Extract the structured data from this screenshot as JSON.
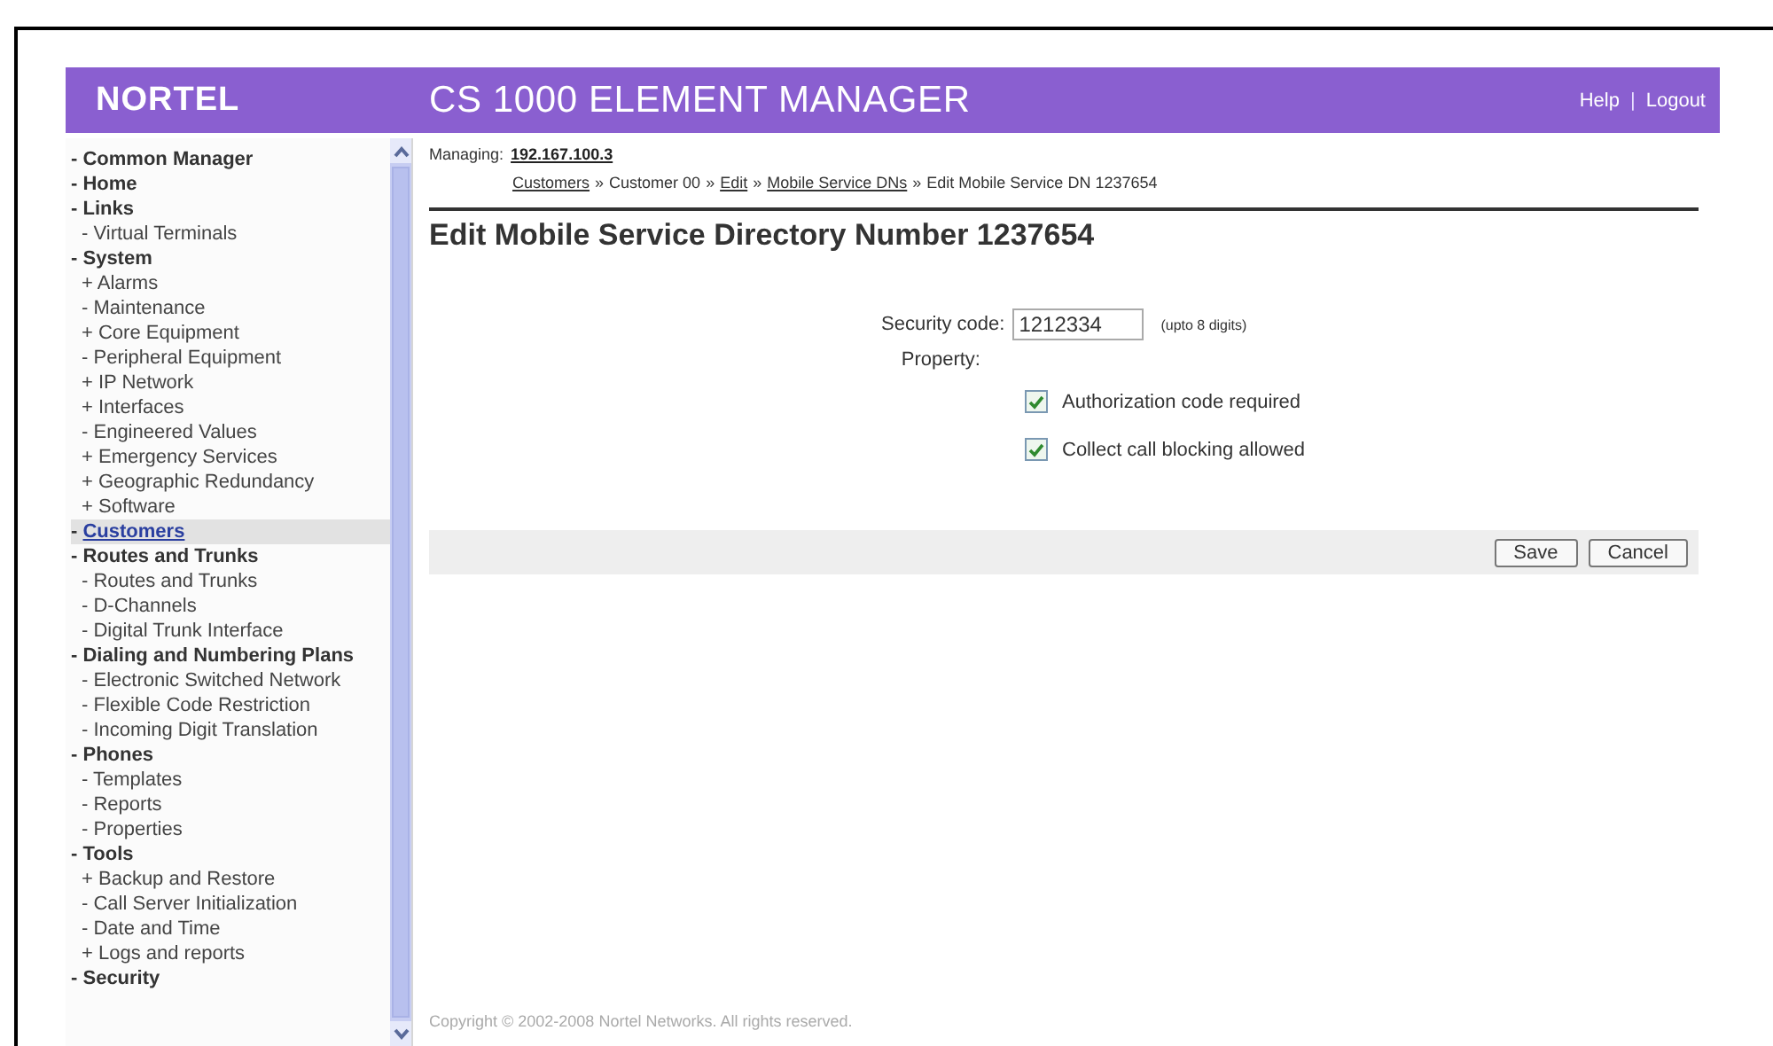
{
  "header": {
    "logo": "NORTEL",
    "title": "CS 1000 ELEMENT MANAGER",
    "links": [
      "Help",
      "Logout"
    ],
    "separator": "|"
  },
  "sidebar": {
    "items": [
      {
        "prefix": "-",
        "label": "Common Manager",
        "selected": false
      },
      {
        "prefix": "-",
        "label": "Home",
        "selected": false
      },
      {
        "prefix": "-",
        "label": "Links",
        "selected": false,
        "children": [
          {
            "prefix": "-",
            "label": "Virtual Terminals",
            "selected": false
          }
        ]
      },
      {
        "prefix": "-",
        "label": "System",
        "selected": false,
        "children": [
          {
            "prefix": "+",
            "label": "Alarms",
            "selected": false
          },
          {
            "prefix": "-",
            "label": "Maintenance",
            "selected": false
          },
          {
            "prefix": "+",
            "label": "Core Equipment",
            "selected": false
          },
          {
            "prefix": "-",
            "label": "Peripheral Equipment",
            "selected": false
          },
          {
            "prefix": "+",
            "label": "IP Network",
            "selected": false
          },
          {
            "prefix": "+",
            "label": "Interfaces",
            "selected": false
          },
          {
            "prefix": "-",
            "label": "Engineered Values",
            "selected": false
          },
          {
            "prefix": "+",
            "label": "Emergency Services",
            "selected": false
          },
          {
            "prefix": "+",
            "label": "Geographic Redundancy",
            "selected": false
          },
          {
            "prefix": "+",
            "label": "Software",
            "selected": false
          }
        ]
      },
      {
        "prefix": "-",
        "label": "Customers",
        "selected": true
      },
      {
        "prefix": "-",
        "label": "Routes and Trunks",
        "selected": false,
        "children": [
          {
            "prefix": "-",
            "label": "Routes and Trunks",
            "selected": false
          },
          {
            "prefix": "-",
            "label": "D-Channels",
            "selected": false
          },
          {
            "prefix": "-",
            "label": "Digital Trunk Interface",
            "selected": false
          }
        ]
      },
      {
        "prefix": "-",
        "label": "Dialing and Numbering Plans",
        "selected": false,
        "children": [
          {
            "prefix": "-",
            "label": "Electronic Switched Network",
            "selected": false
          },
          {
            "prefix": "-",
            "label": "Flexible Code Restriction",
            "selected": false
          },
          {
            "prefix": "-",
            "label": "Incoming Digit Translation",
            "selected": false
          }
        ]
      },
      {
        "prefix": "-",
        "label": "Phones",
        "selected": false,
        "children": [
          {
            "prefix": "-",
            "label": "Templates",
            "selected": false
          },
          {
            "prefix": "-",
            "label": "Reports",
            "selected": false
          },
          {
            "prefix": "-",
            "label": "Properties",
            "selected": false
          }
        ]
      },
      {
        "prefix": "-",
        "label": "Tools",
        "selected": false,
        "children": [
          {
            "prefix": "+",
            "label": "Backup and Restore",
            "selected": false
          },
          {
            "prefix": "-",
            "label": "Call Server Initialization",
            "selected": false
          },
          {
            "prefix": "-",
            "label": "Date and Time",
            "selected": false
          },
          {
            "prefix": "+",
            "label": "Logs and reports",
            "selected": false
          }
        ]
      },
      {
        "prefix": "-",
        "label": "Security",
        "selected": false
      }
    ]
  },
  "managing": {
    "label": "Managing:",
    "address": "192.167.100.3"
  },
  "breadcrumb": [
    {
      "text": "Customers",
      "link": true
    },
    {
      "text": "»",
      "link": false
    },
    {
      "text": "Customer 00",
      "link": false
    },
    {
      "text": "»",
      "link": false
    },
    {
      "text": "Edit",
      "link": true
    },
    {
      "text": "»",
      "link": false
    },
    {
      "text": "Mobile Service DNs",
      "link": true
    },
    {
      "text": "»",
      "link": false
    },
    {
      "text": "Edit Mobile Service DN 1237654",
      "link": false
    }
  ],
  "heading": "Edit Mobile Service Directory Number 1237654",
  "form": {
    "security_code": {
      "label": "Security code:",
      "value": "1212334",
      "hint": "(upto 8 digits)"
    },
    "property_label": "Property:",
    "options": [
      {
        "label": "Authorization code required",
        "checked": true
      },
      {
        "label": "Collect call blocking allowed",
        "checked": true
      }
    ]
  },
  "buttons": [
    "Save",
    "Cancel"
  ],
  "footer": "Copyright © 2002-2008 Nortel Networks. All rights reserved."
}
